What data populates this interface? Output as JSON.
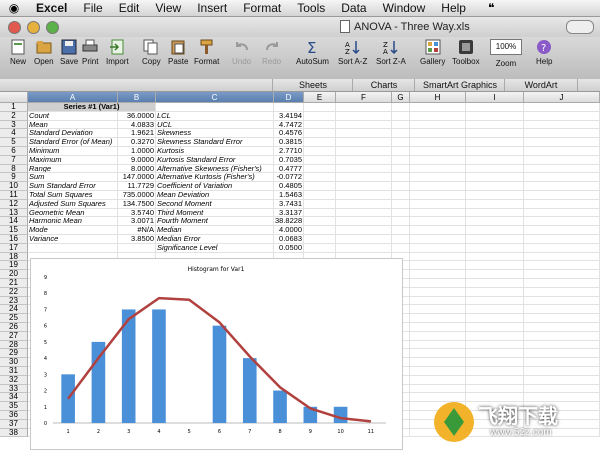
{
  "menubar": {
    "items": [
      "Excel",
      "File",
      "Edit",
      "View",
      "Insert",
      "Format",
      "Tools",
      "Data",
      "Window",
      "Help"
    ]
  },
  "window": {
    "title": "ANOVA - Three Way.xls"
  },
  "toolbar": {
    "buttons": [
      {
        "label": "New",
        "icon": "new-workbook-icon"
      },
      {
        "label": "Open",
        "icon": "open-folder-icon"
      },
      {
        "label": "Save",
        "icon": "save-icon"
      },
      {
        "label": "Print",
        "icon": "print-icon"
      },
      {
        "label": "Import",
        "icon": "import-icon"
      },
      {
        "label": "Copy",
        "icon": "copy-icon"
      },
      {
        "label": "Paste",
        "icon": "paste-icon"
      },
      {
        "label": "Format",
        "icon": "format-brush-icon"
      },
      {
        "label": "Undo",
        "icon": "undo-icon"
      },
      {
        "label": "Redo",
        "icon": "redo-icon"
      },
      {
        "label": "AutoSum",
        "icon": "sigma-icon"
      },
      {
        "label": "Sort A-Z",
        "icon": "sort-ascending-icon"
      },
      {
        "label": "Sort Z-A",
        "icon": "sort-descending-icon"
      },
      {
        "label": "Gallery",
        "icon": "gallery-icon"
      },
      {
        "label": "Toolbox",
        "icon": "toolbox-icon"
      },
      {
        "label": "Zoom",
        "icon": "zoom-icon"
      },
      {
        "label": "Help",
        "icon": "help-icon"
      }
    ],
    "zoom_value": "100%"
  },
  "ribbon_tabs": [
    "Sheets",
    "Charts",
    "SmartArt Graphics",
    "WordArt"
  ],
  "columns": [
    "A",
    "B",
    "C",
    "D",
    "E",
    "F",
    "G",
    "H",
    "I",
    "J"
  ],
  "rows": [
    {
      "n": "1",
      "a": "Series #1 (Var1)",
      "b": "",
      "c": "",
      "d": ""
    },
    {
      "n": "2",
      "a": "Count",
      "b": "36.0000",
      "c": "LCL",
      "d": "3.4194"
    },
    {
      "n": "3",
      "a": "Mean",
      "b": "4.0833",
      "c": "UCL",
      "d": "4.7472"
    },
    {
      "n": "4",
      "a": "Standard Deviation",
      "b": "1.9621",
      "c": "Skewness",
      "d": "0.4576"
    },
    {
      "n": "5",
      "a": "Standard Error (of Mean)",
      "b": "0.3270",
      "c": "Skewness Standard Error",
      "d": "0.3815"
    },
    {
      "n": "6",
      "a": "Minimum",
      "b": "1.0000",
      "c": "Kurtosis",
      "d": "2.7710"
    },
    {
      "n": "7",
      "a": "Maximum",
      "b": "9.0000",
      "c": "Kurtosis Standard Error",
      "d": "0.7035"
    },
    {
      "n": "8",
      "a": "Range",
      "b": "8.0000",
      "c": "Alternative Skewness (Fisher's)",
      "d": "0.4777"
    },
    {
      "n": "9",
      "a": "Sum",
      "b": "147.0000",
      "c": "Alternative Kurtosis (Fisher's)",
      "d": "-0.0772"
    },
    {
      "n": "10",
      "a": "Sum Standard Error",
      "b": "11.7729",
      "c": "Coefficient of Variation",
      "d": "0.4805"
    },
    {
      "n": "11",
      "a": "Total Sum Squares",
      "b": "735.0000",
      "c": "Mean Deviation",
      "d": "1.5463"
    },
    {
      "n": "12",
      "a": "Adjusted Sum Squares",
      "b": "134.7500",
      "c": "Second Moment",
      "d": "3.7431"
    },
    {
      "n": "13",
      "a": "Geometric Mean",
      "b": "3.5740",
      "c": "Third Moment",
      "d": "3.3137"
    },
    {
      "n": "14",
      "a": "Harmonic Mean",
      "b": "3.0071",
      "c": "Fourth Moment",
      "d": "38.8228"
    },
    {
      "n": "15",
      "a": "Mode",
      "b": "#N/A",
      "c": "Median",
      "d": "4.0000"
    },
    {
      "n": "16",
      "a": "Variance",
      "b": "3.8500",
      "c": "Median Error",
      "d": "0.0683"
    },
    {
      "n": "17",
      "a": "",
      "b": "",
      "c": "Significance Level",
      "d": "0.0500"
    },
    {
      "n": "18",
      "a": "",
      "b": "",
      "c": "",
      "d": ""
    },
    {
      "n": "19",
      "a": "",
      "b": "",
      "c": "",
      "d": ""
    },
    {
      "n": "20",
      "a": "",
      "b": "",
      "c": "",
      "d": ""
    },
    {
      "n": "21",
      "a": "",
      "b": "",
      "c": "",
      "d": ""
    },
    {
      "n": "22",
      "a": "",
      "b": "",
      "c": "",
      "d": ""
    },
    {
      "n": "23",
      "a": "",
      "b": "",
      "c": "",
      "d": ""
    },
    {
      "n": "24",
      "a": "",
      "b": "",
      "c": "",
      "d": ""
    },
    {
      "n": "25",
      "a": "",
      "b": "",
      "c": "",
      "d": ""
    },
    {
      "n": "26",
      "a": "",
      "b": "",
      "c": "",
      "d": ""
    },
    {
      "n": "27",
      "a": "",
      "b": "",
      "c": "",
      "d": ""
    },
    {
      "n": "28",
      "a": "",
      "b": "",
      "c": "",
      "d": ""
    },
    {
      "n": "29",
      "a": "",
      "b": "",
      "c": "",
      "d": ""
    },
    {
      "n": "30",
      "a": "",
      "b": "",
      "c": "",
      "d": ""
    },
    {
      "n": "31",
      "a": "",
      "b": "",
      "c": "",
      "d": ""
    },
    {
      "n": "32",
      "a": "",
      "b": "",
      "c": "",
      "d": ""
    },
    {
      "n": "33",
      "a": "",
      "b": "",
      "c": "",
      "d": ""
    },
    {
      "n": "34",
      "a": "",
      "b": "",
      "c": "",
      "d": ""
    },
    {
      "n": "35",
      "a": "",
      "b": "",
      "c": "",
      "d": ""
    },
    {
      "n": "36",
      "a": "",
      "b": "",
      "c": "",
      "d": ""
    },
    {
      "n": "37",
      "a": "",
      "b": "",
      "c": "",
      "d": ""
    },
    {
      "n": "38",
      "a": "",
      "b": "",
      "c": "",
      "d": ""
    }
  ],
  "chart_data": {
    "type": "bar",
    "title": "Histogram for Var1",
    "categories": [
      "1",
      "2",
      "3",
      "4",
      "5",
      "6",
      "7",
      "8",
      "9",
      "10",
      "11"
    ],
    "values": [
      3,
      5,
      7,
      7,
      0,
      6,
      4,
      2,
      1,
      1,
      0
    ],
    "curve": {
      "x": [
        1,
        2,
        3,
        4,
        5,
        6,
        7,
        8,
        9,
        10,
        11
      ],
      "y": [
        1.5,
        4.0,
        6.4,
        7.7,
        7.6,
        6.2,
        4.1,
        2.2,
        0.9,
        0.3,
        0.1
      ]
    },
    "ylim": [
      0,
      9
    ],
    "yticks": [
      "0",
      "1",
      "2",
      "3",
      "4",
      "5",
      "6",
      "7",
      "8",
      "9"
    ],
    "bar_color": "#4a90d9",
    "curve_color": "#b0413e",
    "grid": false,
    "xlabel": "",
    "ylabel": ""
  },
  "watermark": {
    "brand": "飞翔下载",
    "url": "www.52z.com"
  },
  "colors": {
    "selected_header": "#5a7fae",
    "title_row_bg": "#cfcfcf"
  }
}
